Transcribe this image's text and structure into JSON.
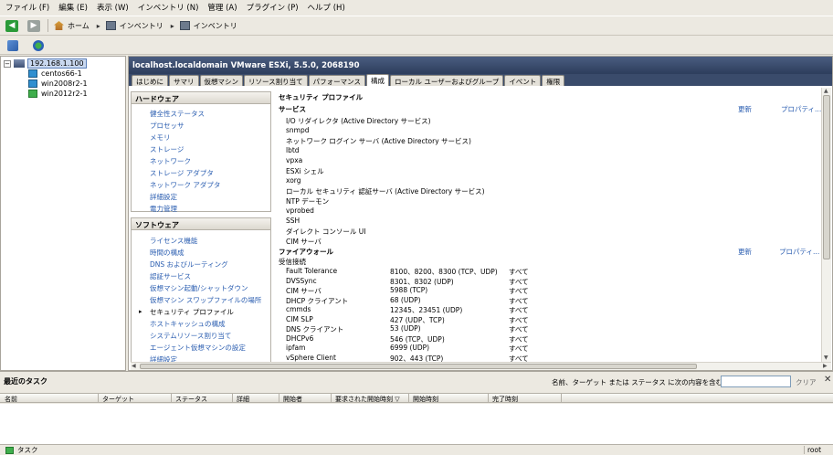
{
  "menu": [
    "ファイル (F)",
    "編集 (E)",
    "表示 (W)",
    "インベントリ (N)",
    "管理 (A)",
    "プラグイン (P)",
    "ヘルプ (H)"
  ],
  "nav": {
    "back_icon": "arrow-left-icon",
    "forward_icon": "arrow-right-icon",
    "breadcrumbs": [
      "ホーム",
      "インベントリ",
      "インベントリ"
    ]
  },
  "tree": {
    "host": "192.168.1.100",
    "vms": [
      "centos66-1",
      "win2008r2-1",
      "win2012r2-1"
    ]
  },
  "main": {
    "title": "localhost.localdomain VMware ESXi, 5.5.0, 2068190",
    "tabs": [
      "はじめに",
      "サマリ",
      "仮想マシン",
      "リソース割り当て",
      "パフォーマンス",
      "構成",
      "ローカル ユーザーおよびグループ",
      "イベント",
      "権限"
    ],
    "active_tab": 5
  },
  "leftnav": {
    "hardware_title": "ハードウェア",
    "hardware": [
      "健全性ステータス",
      "プロセッサ",
      "メモリ",
      "ストレージ",
      "ネットワーク",
      "ストレージ アダプタ",
      "ネットワーク アダプタ",
      "詳細設定",
      "電力管理"
    ],
    "software_title": "ソフトウェア",
    "software": [
      "ライセンス機能",
      "時間の構成",
      "DNS およびルーティング",
      "認証サービス",
      "仮想マシン起動/シャットダウン",
      "仮想マシン スワップファイルの場所",
      "セキュリティ プロファイル",
      "ホストキャッシュの構成",
      "システムリソース割り当て",
      "エージェント仮想マシンの設定",
      "詳細設定"
    ],
    "current_software": 6
  },
  "content": {
    "heading": "セキュリティ プロファイル",
    "services_label": "サービス",
    "refresh": "更新",
    "properties": "プロパティ...",
    "services": [
      "I/O リダイレクタ (Active Directory サービス)",
      "snmpd",
      "ネットワーク ログイン サーバ (Active Directory サービス)",
      "lbtd",
      "vpxa",
      "ESXi シェル",
      "xorg",
      "ローカル セキュリティ 認証サーバ (Active Directory サービス)",
      "NTP デーモン",
      "vprobed",
      "SSH",
      "ダイレクト コンソール UI",
      "CIM サーバ"
    ],
    "firewall_label": "ファイアウォール",
    "incoming_label": "受信接続",
    "firewall": [
      {
        "name": "Fault Tolerance",
        "ports": "8100、8200、8300 (TCP、UDP)",
        "scope": "すべて"
      },
      {
        "name": "DVSSync",
        "ports": "8301、8302 (UDP)",
        "scope": "すべて"
      },
      {
        "name": "CIM サーバ",
        "ports": "5988 (TCP)",
        "scope": "すべて"
      },
      {
        "name": "DHCP クライアント",
        "ports": "68 (UDP)",
        "scope": "すべて"
      },
      {
        "name": "cmmds",
        "ports": "12345、23451 (UDP)",
        "scope": "すべて"
      },
      {
        "name": "CIM SLP",
        "ports": "427 (UDP、TCP)",
        "scope": "すべて"
      },
      {
        "name": "DNS クライアント",
        "ports": "53 (UDP)",
        "scope": "すべて"
      },
      {
        "name": "DHCPv6",
        "ports": "546 (TCP、UDP)",
        "scope": "すべて"
      },
      {
        "name": "ipfam",
        "ports": "6999 (UDP)",
        "scope": "すべて"
      },
      {
        "name": "vSphere Client",
        "ports": "902、443 (TCP)",
        "scope": "すべて"
      }
    ]
  },
  "tasks": {
    "title": "最近のタスク",
    "filter_label": "名前、ターゲット または ステータス に次の内容を含む：▾",
    "clear": "クリア",
    "columns": [
      "名前",
      "ターゲット",
      "ステータス",
      "詳細",
      "開始者",
      "要求された開始時刻 ▽",
      "開始時刻",
      "完了時刻"
    ]
  },
  "status": {
    "tasks_button": "タスク",
    "user": "root"
  }
}
